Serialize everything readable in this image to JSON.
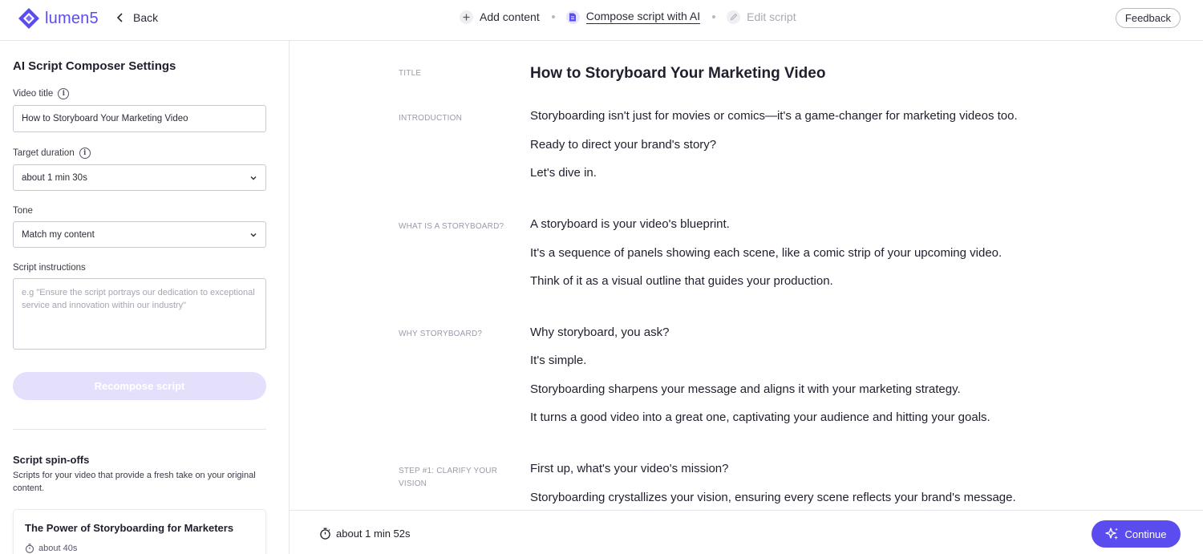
{
  "app": {
    "logo_text": "lumen5",
    "brand_color": "#5b4cf0"
  },
  "topbar": {
    "back_label": "Back",
    "steps": [
      {
        "label": "Add content",
        "icon": "plus-icon",
        "state": "done"
      },
      {
        "label": "Compose script with AI",
        "icon": "document-icon",
        "state": "active"
      },
      {
        "label": "Edit script",
        "icon": "pencil-icon",
        "state": "disabled"
      }
    ],
    "feedback_label": "Feedback"
  },
  "sidebar": {
    "title": "AI Script Composer Settings",
    "video_title_label": "Video title",
    "video_title_value": "How to Storyboard Your Marketing Video",
    "target_duration_label": "Target duration",
    "target_duration_value": "about 1 min 30s",
    "tone_label": "Tone",
    "tone_value": "Match my content",
    "instructions_label": "Script instructions",
    "instructions_placeholder": "e.g \"Ensure the script portrays our dedication to exceptional service and innovation within our industry\"",
    "recompose_label": "Recompose script",
    "spinoffs_title": "Script spin-offs",
    "spinoffs_desc": "Scripts for your video that provide a fresh take on your original content.",
    "spinoff_cards": [
      {
        "title": "The Power of Storyboarding for Marketers",
        "duration": "about 40s"
      }
    ]
  },
  "script": {
    "title_label": "TITLE",
    "title": "How to Storyboard Your Marketing Video",
    "sections": [
      {
        "label": "INTRODUCTION",
        "lines": [
          "Storyboarding isn't just for movies or comics—it's a game-changer for marketing videos too.",
          "Ready to direct your brand's story?",
          "Let's dive in."
        ]
      },
      {
        "label": "WHAT IS A STORYBOARD?",
        "lines": [
          "A storyboard is your video's blueprint.",
          "It's a sequence of panels showing each scene, like a comic strip of your upcoming video.",
          "Think of it as a visual outline that guides your production."
        ]
      },
      {
        "label": "WHY STORYBOARD?",
        "lines": [
          "Why storyboard, you ask?",
          "It's simple.",
          "Storyboarding sharpens your message and aligns it with your marketing strategy.",
          "It turns a good video into a great one, captivating your audience and hitting your goals."
        ]
      },
      {
        "label": "STEP #1: CLARIFY YOUR VISION",
        "lines": [
          "First up, what's your video's mission?",
          "Storyboarding crystallizes your vision, ensuring every scene reflects your brand's message."
        ]
      }
    ]
  },
  "footer": {
    "duration": "about 1 min 52s",
    "continue_label": "Continue"
  }
}
